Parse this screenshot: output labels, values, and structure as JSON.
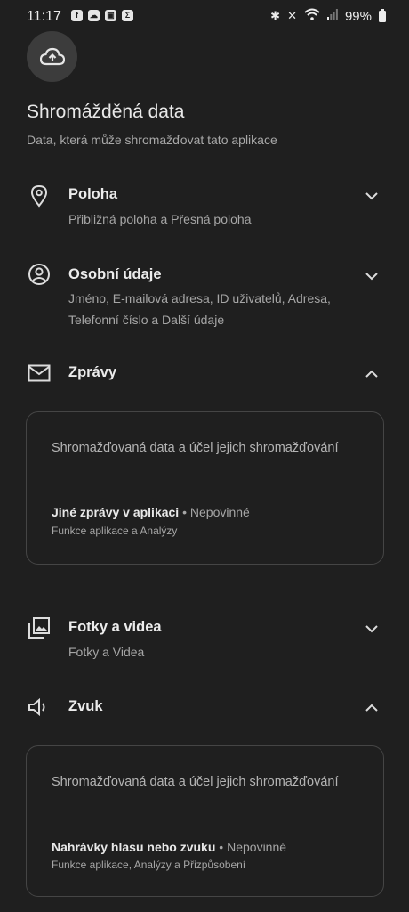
{
  "status_bar": {
    "time": "11:17",
    "left_icons": [
      "facebook-icon",
      "cloud-icon",
      "image-icon",
      "sigma-icon"
    ],
    "right_icons": [
      "bluetooth-icon",
      "mute-icon",
      "wifi-icon",
      "signal-icon"
    ],
    "battery": "99%"
  },
  "header": {
    "icon": "cloud-upload-icon",
    "title": "Shromážděná data",
    "subtitle": "Data, která může shromažďovat tato aplikace"
  },
  "sections": [
    {
      "icon": "location-pin-icon",
      "title": "Poloha",
      "subtitle": "Přibližná poloha a Přesná poloha",
      "expanded": false
    },
    {
      "icon": "person-circle-icon",
      "title": "Osobní údaje",
      "subtitle": "Jméno, E-mailová adresa, ID uživatelů, Adresa, Telefonní číslo a Další údaje",
      "expanded": false
    },
    {
      "icon": "mail-icon",
      "title": "Zprávy",
      "expanded": true,
      "card": {
        "heading": "Shromažďovaná data a účel jejich shromažďování",
        "item_name": "Jiné zprávy v aplikaci",
        "item_separator": " • ",
        "item_status": "Nepovinné",
        "item_purpose": "Funkce aplikace a Analýzy"
      }
    },
    {
      "icon": "photo-library-icon",
      "title": "Fotky a videa",
      "subtitle": "Fotky a Videa",
      "expanded": false
    },
    {
      "icon": "speaker-icon",
      "title": "Zvuk",
      "expanded": true,
      "card": {
        "heading": "Shromažďovaná data a účel jejich shromažďování",
        "item_name": "Nahrávky hlasu nebo zvuku",
        "item_separator": " • ",
        "item_status": "Nepovinné",
        "item_purpose": "Funkce aplikace, Analýzy a Přizpůsobení"
      }
    }
  ]
}
